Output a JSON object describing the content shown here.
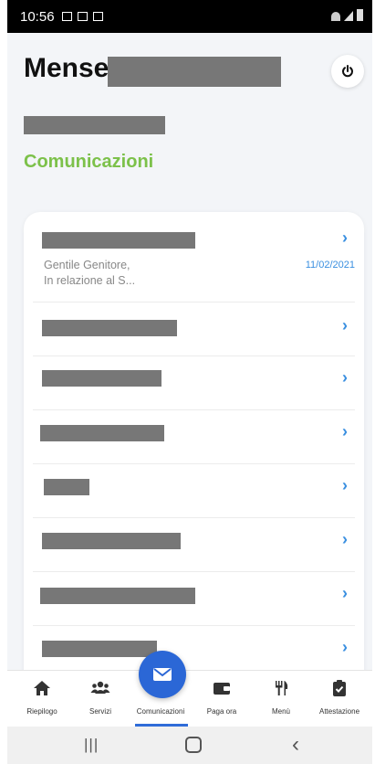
{
  "status_bar": {
    "time": "10:56"
  },
  "header": {
    "title": "Mense",
    "power_icon": "power-icon"
  },
  "section": {
    "title": "Comunicazioni"
  },
  "messages": [
    {
      "preview_line1": "Gentile Genitore,",
      "preview_line2": "In relazione al S...",
      "date": "11/02/2021"
    }
  ],
  "bottom_nav": {
    "items": [
      {
        "label": "Riepilogo",
        "icon": "home-icon"
      },
      {
        "label": "Servizi",
        "icon": "users-icon"
      },
      {
        "label": "Comunicazioni",
        "icon": "mail-icon"
      },
      {
        "label": "Paga ora",
        "icon": "wallet-icon"
      },
      {
        "label": "Menù",
        "icon": "cutlery-icon"
      },
      {
        "label": "Attestazione",
        "icon": "clipboard-icon"
      }
    ],
    "active": "Comunicazioni"
  },
  "colors": {
    "accent_green": "#7cc14a",
    "accent_blue": "#2b67d6",
    "link_blue": "#3a8fe0"
  }
}
